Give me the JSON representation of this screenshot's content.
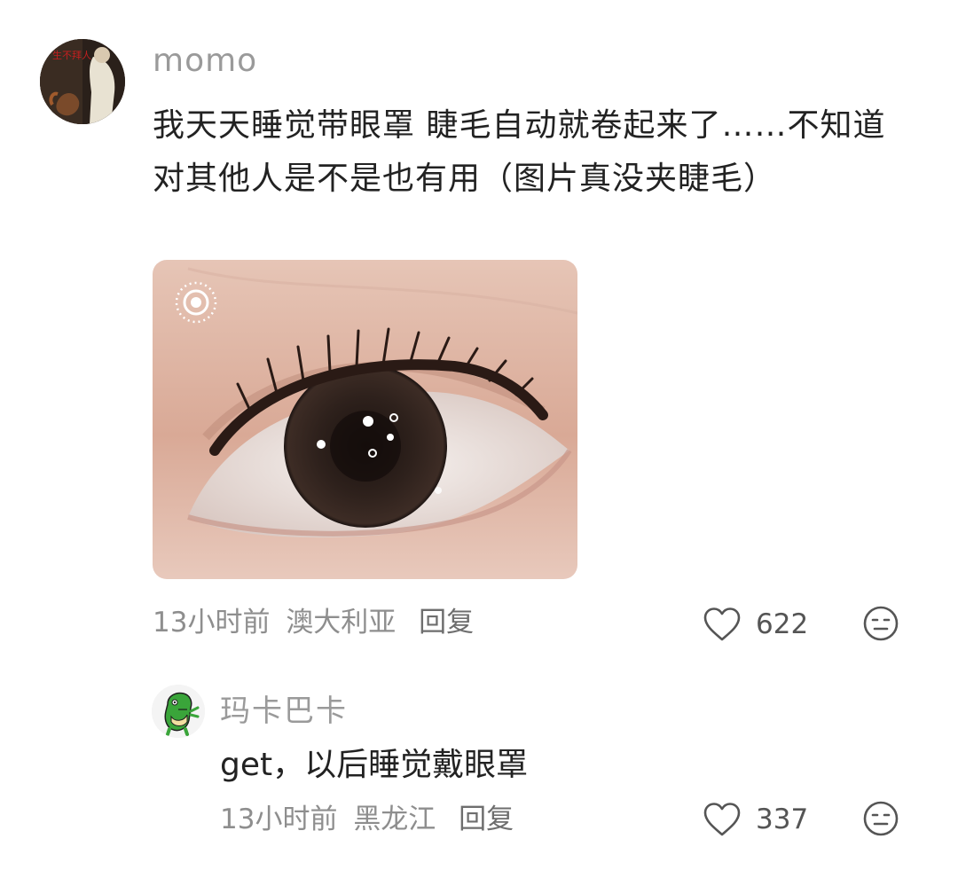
{
  "comments": [
    {
      "username": "momo",
      "avatar_text": "生不拜人",
      "content": "我天天睡觉带眼罩 睫毛自动就卷起来了……不知道对其他人是不是也有用（图片真没夹睫毛）",
      "time": "13小时前",
      "location": "澳大利亚",
      "reply_label": "回复",
      "likes": "622"
    },
    {
      "username": "玛卡巴卡",
      "content": "get，以后睡觉戴眼罩",
      "time": "13小时前",
      "location": "黑龙江",
      "reply_label": "回复",
      "likes": "337"
    }
  ],
  "icons": {
    "like": "heart-outline-icon",
    "dislike": "meh-face-icon",
    "live_photo": "live-photo-icon"
  },
  "colors": {
    "username": "#9a9a9a",
    "meta": "#8e8e8e",
    "text": "#222222"
  }
}
